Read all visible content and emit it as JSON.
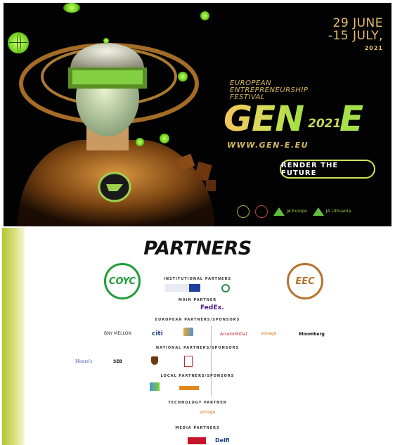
{
  "banner": {
    "dates": {
      "line1": "29 JUNE",
      "line2": "-15 JULY,",
      "line3": "2021"
    },
    "festival": [
      "EUROPEAN",
      "ENTREPRENEURSHIP",
      "FESTIVAL"
    ],
    "gen": "GEN",
    "year": "2021",
    "e": "E",
    "url": "WWW.GEN-E.EU",
    "cta": "RENDER THE FUTURE",
    "footer_logos": [
      "JA Europe",
      "JA Lithuania"
    ],
    "colors": {
      "accent_green": "#a6e049",
      "gold": "#e6c06a",
      "background": "#020202"
    }
  },
  "partners": {
    "title": "PARTNERS",
    "left_badge": "COYC",
    "right_badge": "EEC",
    "sections": [
      {
        "label": "INSTITUTIONAL PARTNERS"
      },
      {
        "label": "MAIN PARTNER"
      },
      {
        "label": "EUROPEAN PARTNERS/SPONSORS"
      },
      {
        "label": "NATIONAL PARTNERS/SPONSORS"
      },
      {
        "label": "LOCAL PARTNERS/SPONSORS"
      },
      {
        "label": "TECHNOLOGY PARTNER"
      },
      {
        "label": "MEDIA PARTNERS"
      }
    ],
    "logos": {
      "main": "FedEx.",
      "european": [
        "BNY MELLON",
        "citi",
        "ArcelorMittal",
        "Bloomberg"
      ],
      "national": [
        "Moore's",
        "SEB",
        "ups"
      ],
      "technology": "vonage",
      "media": [
        "Delfi"
      ]
    },
    "colors": {
      "side_bar": "#b4c235",
      "coyc": "#1f9d3a",
      "eec": "#b5722d",
      "fedex_purple": "#4d148c",
      "fedex_orange": "#ff6600"
    }
  }
}
